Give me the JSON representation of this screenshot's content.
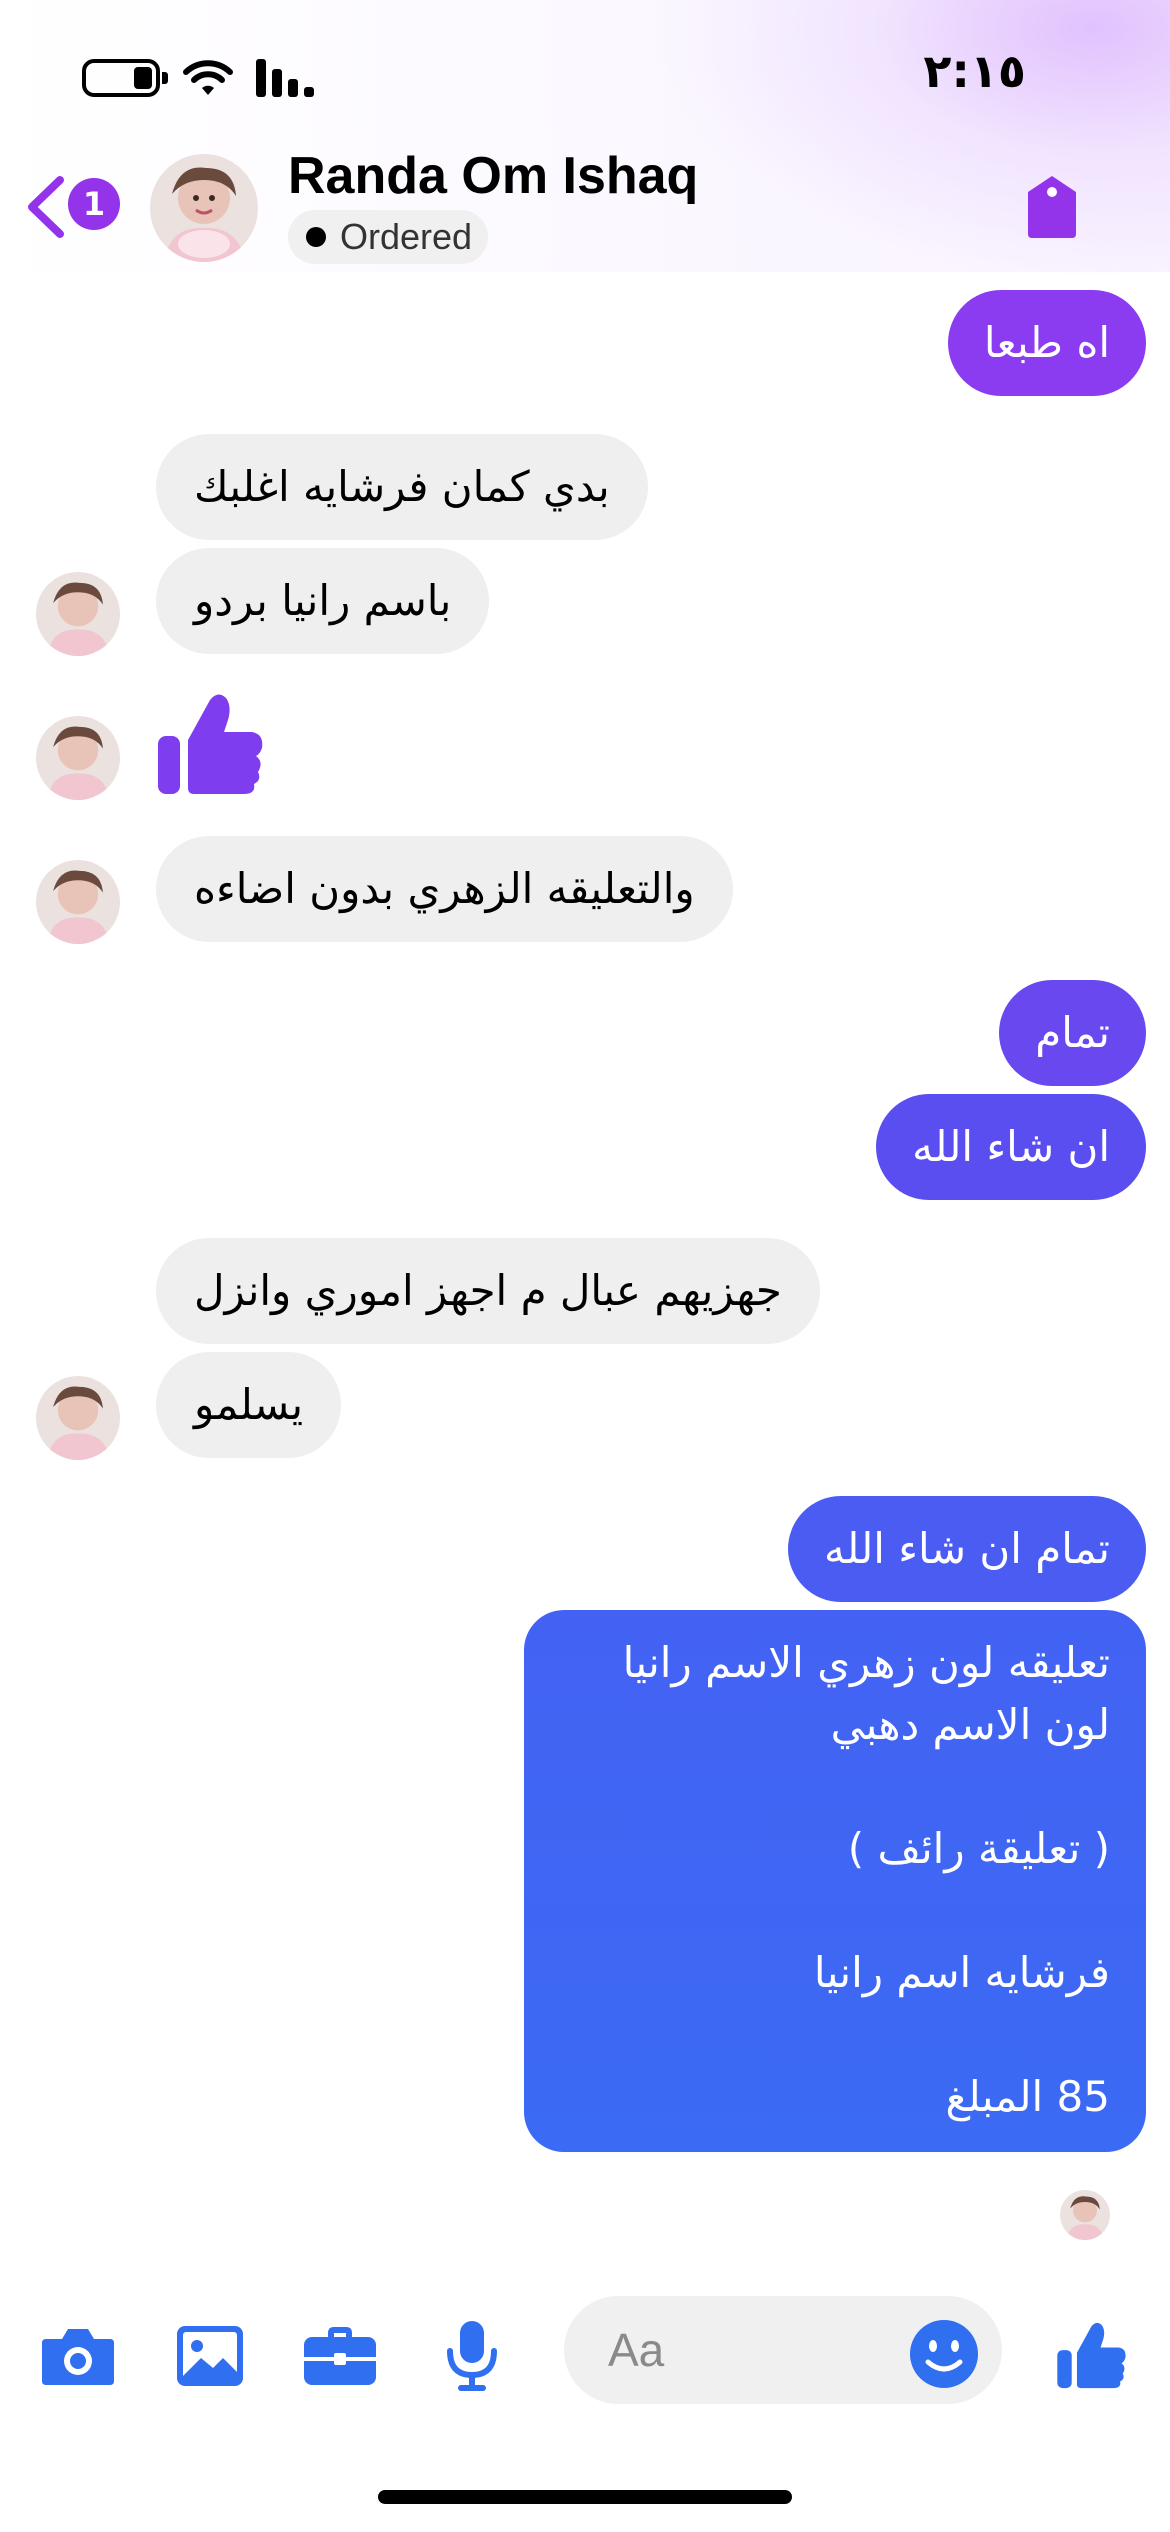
{
  "status_bar": {
    "time": "٢:١٥"
  },
  "header": {
    "back_badge": "1",
    "contact_name": "Randa Om Ishaq",
    "status": "Ordered"
  },
  "messages": [
    {
      "side": "out",
      "text": "اه طبعا"
    },
    {
      "side": "in",
      "text": "بدي كمان فرشايه اغلبك"
    },
    {
      "side": "in",
      "text": "باسم رانيا بردو"
    },
    {
      "side": "in",
      "type": "like",
      "icon": "thumbs-up-icon"
    },
    {
      "side": "in",
      "text": "والتعليقه الزهري بدون اضاءه"
    },
    {
      "side": "out",
      "text": "تمام"
    },
    {
      "side": "out",
      "text": "ان شاء الله"
    },
    {
      "side": "in",
      "text": "جهزيهم عبال م اجهز اموري وانزل"
    },
    {
      "side": "in",
      "text": "يسلمو"
    },
    {
      "side": "out",
      "text": "تمام ان شاء الله"
    },
    {
      "side": "out",
      "text": "تعليقه لون زهري الاسم رانيا لون الاسم دهبي\n\n( تعليقة رائف )\n\nفرشايه اسم رانيا\n\n85 المبلغ"
    }
  ],
  "composer": {
    "placeholder": "Aa",
    "icons": [
      "camera-icon",
      "photo-icon",
      "briefcase-icon",
      "microphone-icon",
      "emoji-icon",
      "thumbs-up-icon"
    ]
  },
  "colors": {
    "accent_purple": "#9333ea",
    "outgoing_top": "#8b3cf0",
    "outgoing_mid": "#5b4ef0",
    "outgoing_bottom": "#3b6af4",
    "incoming": "#efefef",
    "composer_icon": "#2f6ff0"
  }
}
